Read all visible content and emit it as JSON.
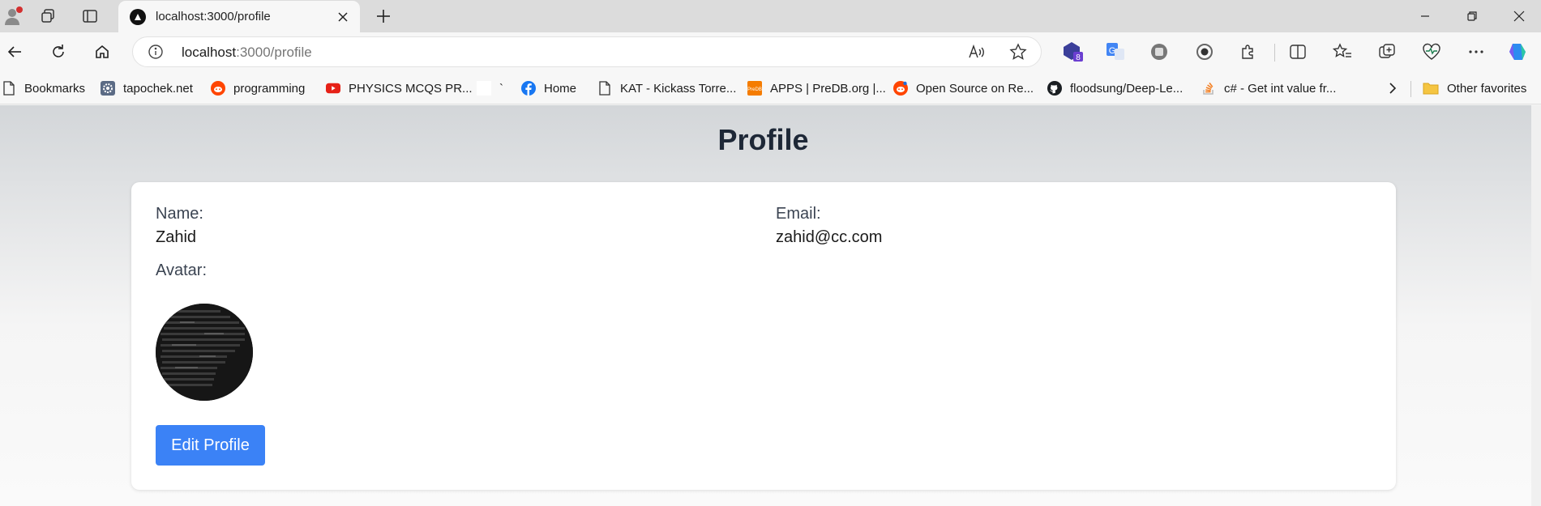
{
  "browser": {
    "tab": {
      "title": "localhost:3000/profile"
    },
    "address": {
      "host": "localhost",
      "path": ":3000/profile"
    },
    "profile_badge": "8"
  },
  "bookmarks": [
    {
      "label": "Bookmarks",
      "icon": "file-icon"
    },
    {
      "label": "tapochek.net",
      "icon": "gear-icon"
    },
    {
      "label": "programming",
      "icon": "reddit-icon"
    },
    {
      "label": "PHYSICS MCQS PR...",
      "icon": "youtube-icon"
    },
    {
      "label": "`",
      "icon": "blank-icon"
    },
    {
      "label": "Home",
      "icon": "facebook-icon"
    },
    {
      "label": "KAT - Kickass Torre...",
      "icon": "file-icon"
    },
    {
      "label": "APPS | PreDB.org |...",
      "icon": "predb-icon"
    },
    {
      "label": "Open Source on Re...",
      "icon": "reddit-icon"
    },
    {
      "label": "floodsung/Deep-Le...",
      "icon": "github-icon"
    },
    {
      "label": "c# - Get int value fr...",
      "icon": "stackoverflow-icon"
    }
  ],
  "other_favorites": "Other favorites",
  "page": {
    "title": "Profile",
    "name_label": "Name:",
    "name_value": "Zahid",
    "email_label": "Email:",
    "email_value": "zahid@cc.com",
    "avatar_label": "Avatar:",
    "edit_button": "Edit Profile"
  },
  "colors": {
    "primary_button": "#3b82f6",
    "title": "#1e2837"
  }
}
